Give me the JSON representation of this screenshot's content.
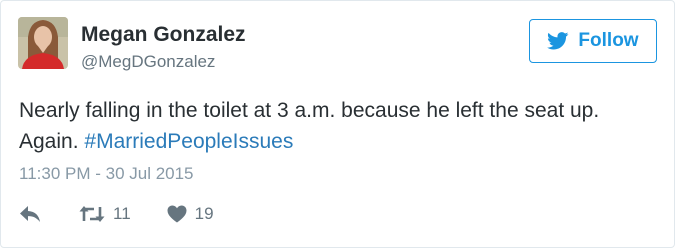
{
  "user": {
    "display_name": "Megan Gonzalez",
    "handle": "@MegDGonzalez"
  },
  "follow_button": {
    "label": "Follow"
  },
  "tweet": {
    "line1": "Nearly falling in the toilet at 3 a.m. because he left the seat up.",
    "line2_text": "Again. ",
    "hashtag": "#MarriedPeopleIssues",
    "timestamp": "11:30 PM - 30 Jul 2015"
  },
  "actions": {
    "reply_icon": "reply-icon",
    "retweet_icon": "retweet-icon",
    "retweet_count": "11",
    "like_icon": "heart-icon",
    "like_count": "19"
  },
  "colors": {
    "accent": "#1b95e0",
    "hashtag": "#2b7bb9",
    "secondary_text": "#8899a6",
    "icon_gray": "#66757f"
  }
}
